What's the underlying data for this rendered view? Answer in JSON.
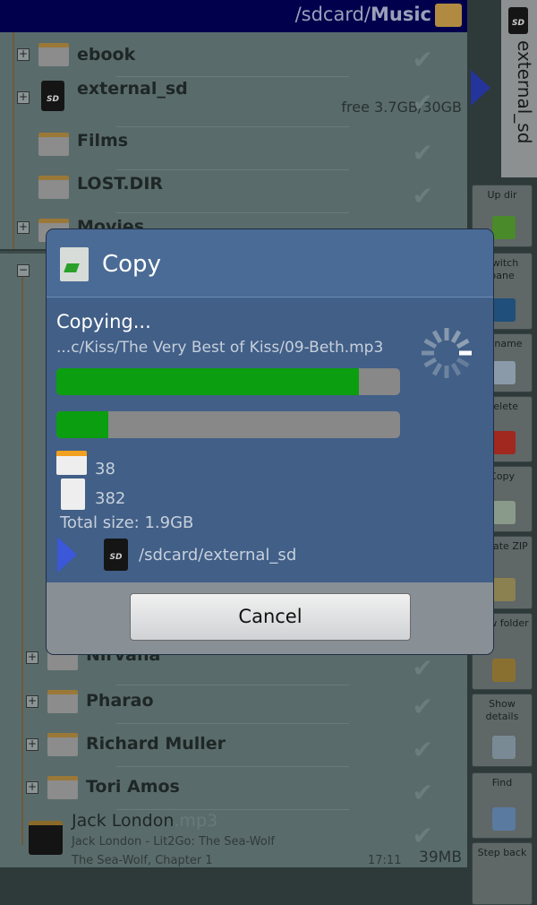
{
  "header": {
    "path_prefix": "/sdcard/",
    "path_current": "Music"
  },
  "pane1": {
    "items": [
      {
        "name": "ebook",
        "type": "folder",
        "expandable": true
      },
      {
        "name": "external_sd",
        "type": "sdcard",
        "expandable": true,
        "info": "free 3.7GB/30GB"
      },
      {
        "name": "Films",
        "type": "folder",
        "expandable": false
      },
      {
        "name": "LOST.DIR",
        "type": "folder",
        "expandable": false
      },
      {
        "name": "Movies",
        "type": "folder",
        "expandable": true
      }
    ]
  },
  "pane2": {
    "items": [
      {
        "name": "Nirvana"
      },
      {
        "name": "Pharao"
      },
      {
        "name": "Richard Muller"
      },
      {
        "name": "Tori Amos"
      }
    ],
    "file": {
      "name": "Jack London",
      "ext": ".mp3",
      "artist_album": "Jack London - Lit2Go: The Sea-Wolf",
      "title": "The Sea-Wolf, Chapter 1",
      "time": "17:11",
      "size": "39MB"
    }
  },
  "side_tab": {
    "label": "external_sd"
  },
  "toolbar": [
    {
      "label": "Up dir",
      "icon": "up-arrow-icon",
      "color": "#4a8a2a"
    },
    {
      "label": "Switch pane",
      "icon": "switch-pane-icon",
      "color": "#1f4f7a"
    },
    {
      "label": "Rename",
      "icon": "rename-icon",
      "color": "#8a9aa8"
    },
    {
      "label": "Delete",
      "icon": "trash-icon",
      "color": "#a0281e"
    },
    {
      "label": "Copy",
      "icon": "copy-icon",
      "color": "#8a9a8a"
    },
    {
      "label": "Create ZIP",
      "icon": "zip-icon",
      "color": "#8a8050"
    },
    {
      "label": "New folder",
      "icon": "new-folder-icon",
      "color": "#8a7030"
    },
    {
      "label": "Show details",
      "icon": "question-icon",
      "color": "#7a8a95"
    },
    {
      "label": "Find",
      "icon": "search-icon",
      "color": "#5a7aa0"
    },
    {
      "label": "Step back",
      "icon": "back-icon",
      "color": "#5f6767"
    }
  ],
  "dialog": {
    "title": "Copy",
    "status": "Copying...",
    "current_file": "...c/Kiss/The Very Best of Kiss/09-Beth.mp3",
    "file_progress": 0.88,
    "total_progress": 0.15,
    "folders": "38",
    "files": "382",
    "total_size": "Total size:  1.9GB",
    "destination": "/sdcard/external_sd",
    "cancel_label": "Cancel"
  }
}
